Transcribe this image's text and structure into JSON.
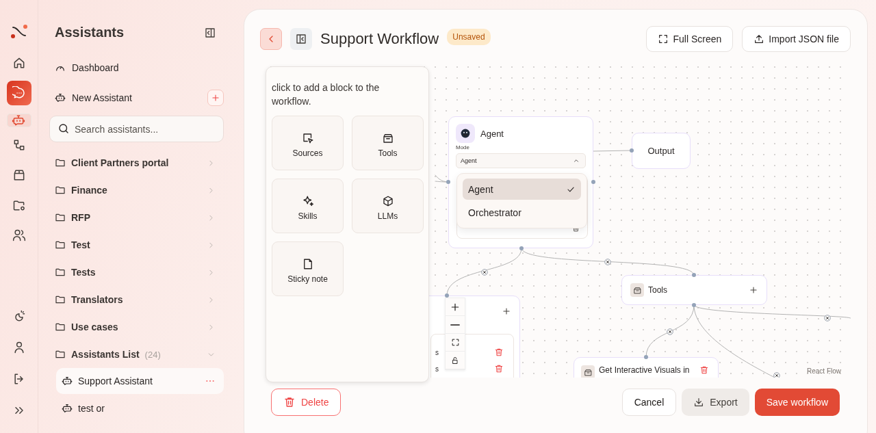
{
  "rail": {
    "items": [
      {
        "kind": "home",
        "highlighted": false,
        "selected": false
      },
      {
        "kind": "chat",
        "highlighted": true,
        "selected": false
      },
      {
        "kind": "bot",
        "highlighted": false,
        "selected": true
      },
      {
        "kind": "workflow",
        "highlighted": false,
        "selected": false
      },
      {
        "kind": "box",
        "highlighted": false,
        "selected": false
      },
      {
        "kind": "folder-settings",
        "highlighted": false,
        "selected": false
      },
      {
        "kind": "users",
        "highlighted": false,
        "selected": false
      }
    ],
    "bottom_items": [
      {
        "kind": "moon"
      },
      {
        "kind": "user"
      },
      {
        "kind": "logout"
      },
      {
        "kind": "chevrons"
      }
    ]
  },
  "sidebar": {
    "title": "Assistants",
    "nav": [
      {
        "label": "Dashboard",
        "kind": "gauge"
      },
      {
        "label": "New Assistant",
        "kind": "bot"
      }
    ],
    "search": {
      "placeholder": "Search assistants..."
    },
    "folders": [
      {
        "label": "Client Partners portal",
        "expanded": false
      },
      {
        "label": "Finance",
        "expanded": false
      },
      {
        "label": "RFP",
        "expanded": false
      },
      {
        "label": "Test",
        "expanded": false
      },
      {
        "label": "Tests",
        "expanded": false
      },
      {
        "label": "Translators",
        "expanded": false
      },
      {
        "label": "Use cases",
        "expanded": false
      },
      {
        "label": "Assistants List",
        "count": "(24)",
        "expanded": true,
        "children": [
          {
            "label": "Support Assistant",
            "selected": true
          },
          {
            "label": "test or",
            "selected": false
          }
        ]
      }
    ]
  },
  "header": {
    "title": "Support Workflow",
    "badge": "Unsaved",
    "buttons": [
      {
        "label": "Full Screen",
        "kind": "fullscreen"
      },
      {
        "label": "Import JSON file",
        "kind": "upload"
      }
    ]
  },
  "palette": {
    "hint": "click to add a block to the workflow.",
    "blocks": [
      {
        "label": "Sources",
        "kind": "pointer"
      },
      {
        "label": "Tools",
        "kind": "toolbox"
      },
      {
        "label": "Skills",
        "kind": "sparkles"
      },
      {
        "label": "LLMs",
        "kind": "cube"
      },
      {
        "label": "Sticky note",
        "kind": "note"
      }
    ]
  },
  "canvas": {
    "agent": {
      "title": "Agent",
      "mode_label": "Mode",
      "mode_value": "Agent",
      "dropdown": {
        "expanded": true,
        "options": [
          {
            "label": "Agent",
            "selected": true
          },
          {
            "label": "Orchestrator",
            "selected": false
          }
        ]
      }
    },
    "output": {
      "label": "Output"
    },
    "tools": {
      "label": "Tools"
    },
    "visuals": {
      "label": "Get Interactive Visuals in"
    },
    "partial": {
      "rows": [
        "s",
        "s"
      ]
    },
    "attribution": "React Flow"
  },
  "footer": {
    "delete": "Delete",
    "buttons": [
      {
        "label": "Cancel",
        "kind": "cancel"
      },
      {
        "label": "Export",
        "kind": "export"
      },
      {
        "label": "Save workflow",
        "kind": "save"
      }
    ]
  }
}
